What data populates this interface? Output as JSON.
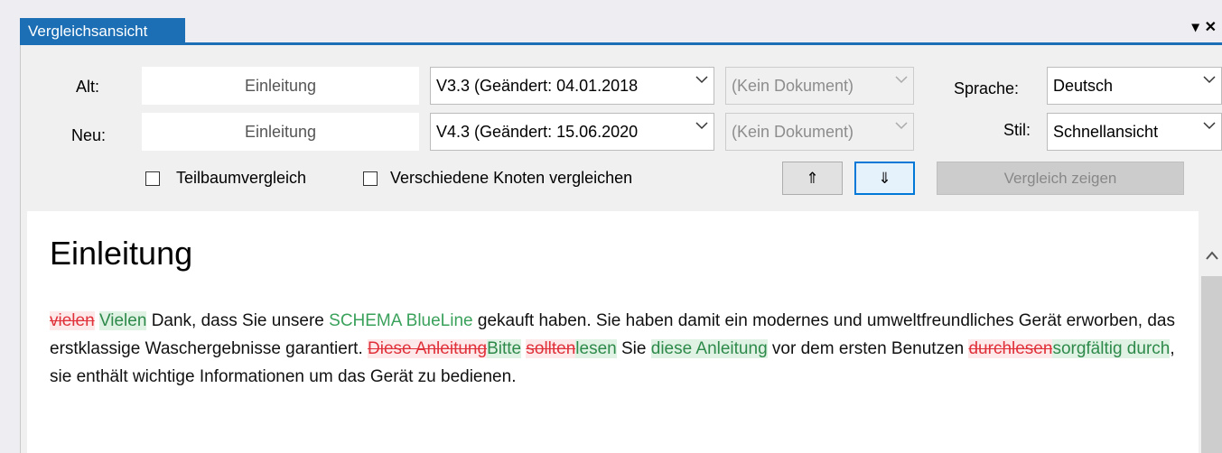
{
  "tab": {
    "title": "Vergleichsansicht"
  },
  "window_controls": {
    "pin": "▾",
    "close": "✕"
  },
  "labels": {
    "alt": "Alt:",
    "neu": "Neu:",
    "sprache": "Sprache:",
    "stil": "Stil:"
  },
  "old_row": {
    "node": "Einleitung",
    "version": "V3.3 (Geändert: 04.01.2018",
    "document": "(Kein Dokument)"
  },
  "new_row": {
    "node": "Einleitung",
    "version": "V4.3 (Geändert: 15.06.2020",
    "document": "(Kein Dokument)"
  },
  "language": {
    "selected": "Deutsch"
  },
  "style": {
    "selected": "Schnellansicht"
  },
  "options": {
    "subtree": "Teilbaumvergleich",
    "different_nodes": "Verschiedene Knoten vergleichen"
  },
  "nav": {
    "up": "⇑",
    "down": "⇓"
  },
  "compare_button": "Vergleich zeigen",
  "document": {
    "heading": "Einleitung",
    "p1": "vielen",
    "p2": "Vielen",
    "p3": " Dank, dass Sie unsere ",
    "p4": "SCHEMA BlueLine",
    "p5": " gekauft haben. Sie haben damit ein modernes und umweltfreundliches Gerät erworben, das erstklassige Waschergebnisse garantiert. ",
    "p6": "Diese Anleitung",
    "p7": "Bitte",
    "p8": "sollten",
    "p9": "lesen",
    "p10": " Sie ",
    "p11": "diese Anleitung",
    "p12": " vor dem ersten Benutzen ",
    "p13": "durchlesen",
    "p14": "sorgfältig durch",
    "p15": ", sie enthält wichtige Informationen um das Gerät zu bedienen."
  },
  "colors": {
    "accent": "#1c6fb4",
    "deleted": "#e0313a",
    "inserted": "#2e8a4b"
  }
}
